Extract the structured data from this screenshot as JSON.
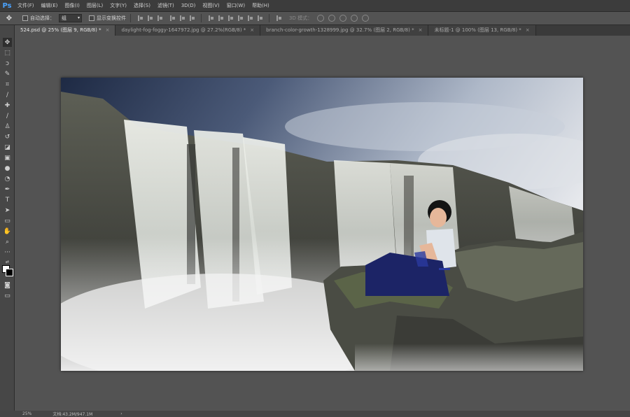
{
  "app": {
    "logo": "Ps"
  },
  "menu": [
    "文件(F)",
    "编辑(E)",
    "图像(I)",
    "图层(L)",
    "文字(Y)",
    "选择(S)",
    "滤镜(T)",
    "3D(D)",
    "视图(V)",
    "窗口(W)",
    "帮助(H)"
  ],
  "options": {
    "auto_select_label": "自动选择：",
    "auto_select_value": "组",
    "show_transform_label": "显示变换控件",
    "mode_label": "3D 模式："
  },
  "tabs": [
    {
      "label": "524.psd @ 25% (图层 9, RGB/8) *",
      "active": true
    },
    {
      "label": "daylight-fog-foggy-1647972.jpg @ 27.2%(RGB/8) *",
      "active": false
    },
    {
      "label": "branch-color-growth-1328999.jpg @ 32.7% (图层 2, RGB/8) *",
      "active": false
    },
    {
      "label": "未标题-1 @ 100% (图层 13, RGB/8) *",
      "active": false
    }
  ],
  "status": {
    "zoom": "25%",
    "doc": "文档:43.2M/947.1M",
    "arrow": "›"
  },
  "icons": [
    "move-icon",
    "marquee-icon",
    "lasso-icon",
    "quick-select-icon",
    "crop-icon",
    "eyedropper-icon",
    "healing-icon",
    "brush-icon",
    "stamp-icon",
    "history-brush-icon",
    "eraser-icon",
    "gradient-icon",
    "blur-icon",
    "dodge-icon",
    "pen-icon",
    "type-icon",
    "path-select-icon",
    "shape-icon",
    "hand-icon",
    "zoom-icon",
    "more-icon"
  ]
}
